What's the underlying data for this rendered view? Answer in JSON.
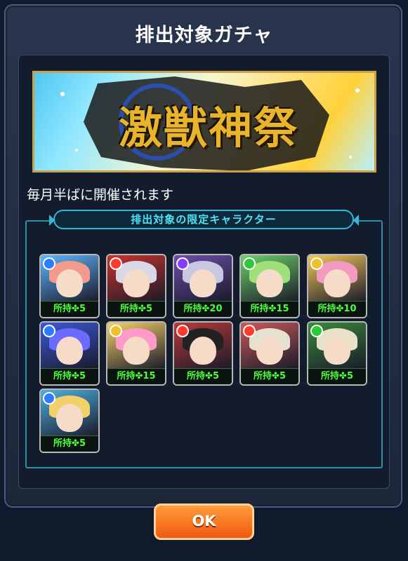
{
  "dialog": {
    "title": "排出対象ガチャ",
    "banner_title": "激獣神祭",
    "schedule_text": "毎月半ばに開催されます",
    "section_title": "排出対象の限定キャラクター",
    "ok_label": "OK"
  },
  "owned_prefix": "所持",
  "clover_icon": "✤",
  "characters": [
    {
      "owned_label": "5",
      "attribute": "water",
      "attr_color": "#2e7bff",
      "bg": "#5fb6ff",
      "hair": "#f29a8c"
    },
    {
      "owned_label": "5",
      "attribute": "fire",
      "attr_color": "#ff3b2e",
      "bg": "#c8342c",
      "hair": "#d8d8e8"
    },
    {
      "owned_label": "20",
      "attribute": "dark",
      "attr_color": "#8a3bff",
      "bg": "#6a4fa8",
      "hair": "#c8c8e0"
    },
    {
      "owned_label": "15",
      "attribute": "wood",
      "attr_color": "#2ec83b",
      "bg": "#6fd06a",
      "hair": "#9fe07a"
    },
    {
      "owned_label": "10",
      "attribute": "light",
      "attr_color": "#f2c02e",
      "bg": "#f0c85a",
      "hair": "#f39ac0"
    },
    {
      "owned_label": "5",
      "attribute": "water",
      "attr_color": "#2e7bff",
      "bg": "#3a5ad8",
      "hair": "#6b6bff"
    },
    {
      "owned_label": "15",
      "attribute": "light",
      "attr_color": "#f2c02e",
      "bg": "#f5d36a",
      "hair": "#ff9ac8"
    },
    {
      "owned_label": "5",
      "attribute": "fire",
      "attr_color": "#ff3b2e",
      "bg": "#b83a3a",
      "hair": "#222222"
    },
    {
      "owned_label": "5",
      "attribute": "fire",
      "attr_color": "#ff3b2e",
      "bg": "#c85a5a",
      "hair": "#e6e0d0"
    },
    {
      "owned_label": "5",
      "attribute": "wood",
      "attr_color": "#2ec83b",
      "bg": "#3b8a3b",
      "hair": "#e8e0c8"
    },
    {
      "owned_label": "5",
      "attribute": "water",
      "attr_color": "#2e7bff",
      "bg": "#4fb0e0",
      "hair": "#f2d06a"
    }
  ]
}
